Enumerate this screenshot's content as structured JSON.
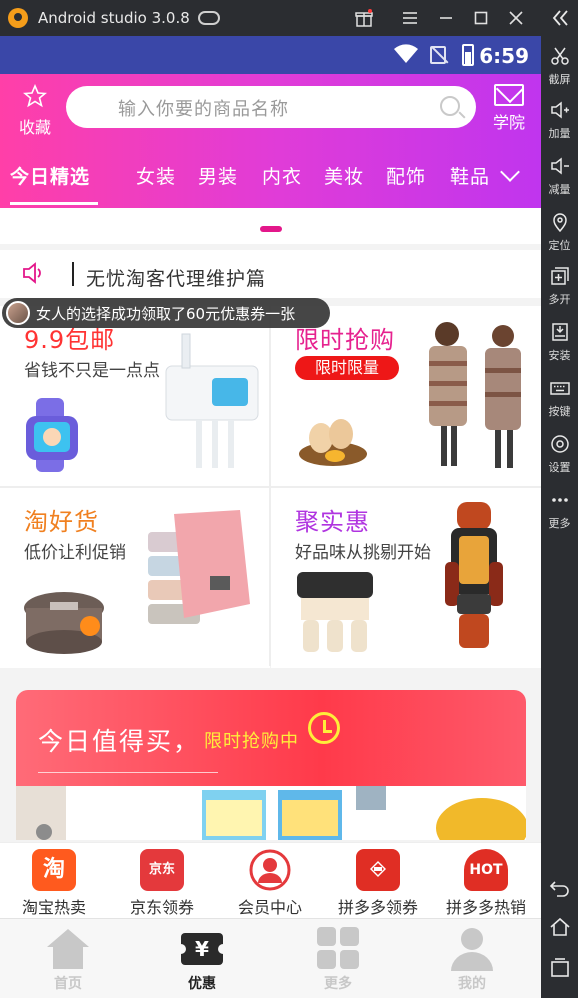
{
  "window": {
    "title": "Android studio 3.0.8"
  },
  "emulator_sidebar": {
    "items": [
      {
        "label": "截屏",
        "icon": "scissors-icon"
      },
      {
        "label": "加量",
        "icon": "volume-up-icon"
      },
      {
        "label": "减量",
        "icon": "volume-down-icon"
      },
      {
        "label": "定位",
        "icon": "location-icon"
      },
      {
        "label": "多开",
        "icon": "multi-open-icon"
      },
      {
        "label": "安装",
        "icon": "apk-install-icon"
      },
      {
        "label": "按键",
        "icon": "keyboard-icon"
      },
      {
        "label": "设置",
        "icon": "settings-icon"
      },
      {
        "label": "更多",
        "icon": "more-icon"
      }
    ]
  },
  "statusbar": {
    "time": "6:59"
  },
  "header": {
    "favorite_label": "收藏",
    "search_placeholder": "输入你要的商品名称",
    "school_label": "学院",
    "categories": [
      "今日精选",
      "女装",
      "男装",
      "内衣",
      "美妆",
      "配饰",
      "鞋品"
    ]
  },
  "notice": {
    "text": "无忧淘客代理维护篇"
  },
  "toast": {
    "text": "女人的选择成功领取了60元优惠券一张"
  },
  "promos": [
    {
      "title": "9.9包邮",
      "subtitle": "省钱不只是一点点",
      "color": "#ff3333"
    },
    {
      "title": "限时抢购",
      "subtitle": "限时限量",
      "color": "#e6228f"
    },
    {
      "title": "淘好货",
      "subtitle": "低价让利促销",
      "color": "#f08020"
    },
    {
      "title": "聚实惠",
      "subtitle": "好品味从挑剔开始",
      "color": "#b034e0"
    }
  ],
  "deal": {
    "title": "今日值得买，",
    "tag": "限时抢购中"
  },
  "quick_links": [
    {
      "label": "淘宝热卖",
      "icon": "taobao-icon",
      "glyph": "淘",
      "color": "#ff5a1e"
    },
    {
      "label": "京东领券",
      "icon": "jd-icon",
      "glyph": "京东",
      "color": "#e4393c"
    },
    {
      "label": "会员中心",
      "icon": "member-icon",
      "glyph": "",
      "color": "#e4393c"
    },
    {
      "label": "拼多多领券",
      "icon": "pinduoduo-icon",
      "glyph": "",
      "color": "#e02e24"
    },
    {
      "label": "拼多多热销",
      "icon": "hot-icon",
      "glyph": "HOT",
      "color": "#e02e24"
    }
  ],
  "tabs": [
    {
      "label": "首页",
      "icon": "home-icon"
    },
    {
      "label": "优惠",
      "icon": "coupon-icon"
    },
    {
      "label": "更多",
      "icon": "grid-icon"
    },
    {
      "label": "我的",
      "icon": "profile-icon"
    }
  ]
}
